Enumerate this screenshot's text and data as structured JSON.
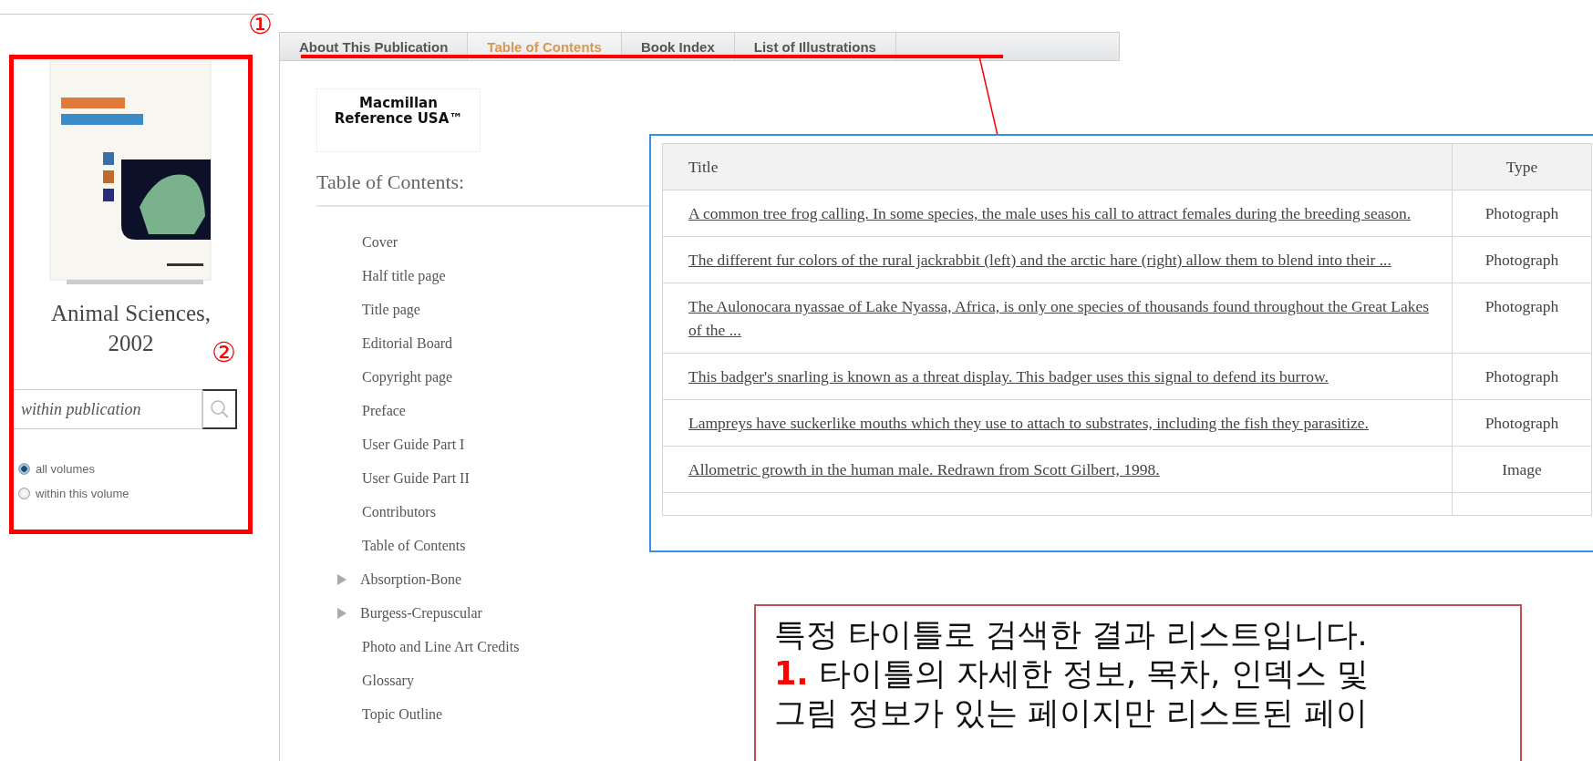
{
  "markers": [
    "①",
    "②"
  ],
  "sidebar": {
    "title": "Animal Sciences, 2002",
    "search": {
      "placeholder": "within publication"
    },
    "scope_options": [
      {
        "label": "all volumes",
        "selected": true
      },
      {
        "label": "within this volume",
        "selected": false
      }
    ]
  },
  "tabs": [
    {
      "label": "About This Publication",
      "selected": false
    },
    {
      "label": "Table of Contents",
      "selected": true
    },
    {
      "label": "Book Index",
      "selected": false
    },
    {
      "label": "List of Illustrations",
      "selected": false
    }
  ],
  "publisher_logo": "Macmillan Reference USA™",
  "toc": {
    "heading": "Table of Contents:",
    "items": [
      {
        "label": "Cover",
        "kind": "leaf"
      },
      {
        "label": "Half title page",
        "kind": "leaf"
      },
      {
        "label": "Title page",
        "kind": "leaf"
      },
      {
        "label": "Editorial Board",
        "kind": "leaf"
      },
      {
        "label": "Copyright page",
        "kind": "leaf"
      },
      {
        "label": "Preface",
        "kind": "leaf"
      },
      {
        "label": "User Guide Part I",
        "kind": "leaf"
      },
      {
        "label": "User Guide Part II",
        "kind": "leaf"
      },
      {
        "label": "Contributors",
        "kind": "leaf"
      },
      {
        "label": "Table of Contents",
        "kind": "leaf"
      },
      {
        "label": "Absorption-Bone",
        "kind": "branch",
        "expanded": false
      },
      {
        "label": "Burgess-Crepuscular",
        "kind": "branch",
        "expanded": false
      },
      {
        "label": "Photo and Line Art Credits",
        "kind": "leaf"
      },
      {
        "label": "Glossary",
        "kind": "leaf"
      },
      {
        "label": "Topic Outline",
        "kind": "leaf"
      }
    ]
  },
  "illustrations_table": {
    "columns": [
      "Title",
      "Type"
    ],
    "rows": [
      [
        "A common tree frog calling. In some species, the male uses his call to attract females during the breeding season.",
        "Photograph"
      ],
      [
        "The different fur colors of the rural jackrabbit (left) and the arctic hare (right) allow them to blend into their ...",
        "Photograph"
      ],
      [
        "The Aulonocara nyassae of Lake Nyassa, Africa, is only one species of thousands found throughout the Great Lakes of the ...",
        "Photograph"
      ],
      [
        "This badger's snarling is known as a threat display. This badger uses this signal to defend its burrow.",
        "Photograph"
      ],
      [
        "Lampreys have suckerlike mouths which they use to attach to substrates, including the fish they parasitize.",
        "Photograph"
      ],
      [
        "Allometric growth in the human male. Redrawn from Scott Gilbert, 1998.",
        "Image"
      ]
    ]
  },
  "callout": {
    "lines": [
      {
        "text": "특정 타이틀로 검색한 결과 리스트입니다."
      },
      {
        "number": "1.",
        "text": "타이틀의 자세한 정보, 목차, 인덱스 및"
      },
      {
        "text": "그림 정보가 있는 페이지만 리스트된 페이"
      }
    ]
  }
}
